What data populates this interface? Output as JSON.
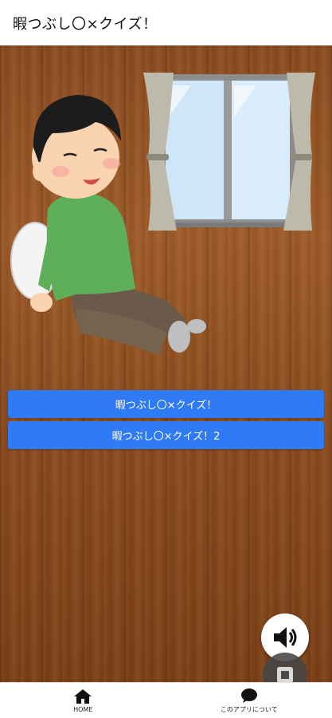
{
  "app": {
    "title": "暇つぶし〇×クイズ！"
  },
  "main": {
    "buttons": [
      {
        "label": "暇つぶし〇×クイズ！"
      },
      {
        "label": "暇つぶし〇×クイズ！2"
      }
    ]
  },
  "fab": {
    "sound_icon": "speaker-icon",
    "stop_icon": "stop-icon"
  },
  "bottom_nav": {
    "items": [
      {
        "label": "HOME",
        "icon": "home-icon"
      },
      {
        "label": "このアプリについて",
        "icon": "chat-bubble-icon"
      }
    ]
  },
  "colors": {
    "button": "#2f7bf5",
    "wood": "#8b4b1d",
    "appbar": "#ffffff"
  }
}
